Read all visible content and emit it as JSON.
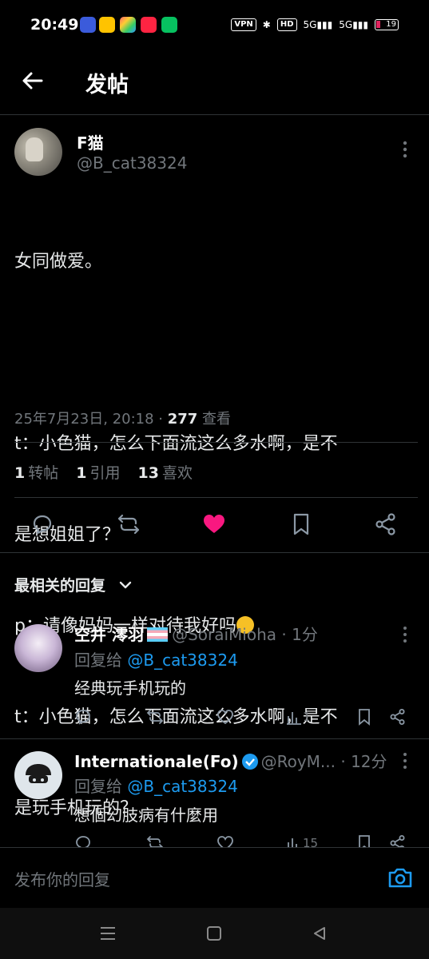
{
  "status_bar": {
    "time": "20:49",
    "vpn": "VPN",
    "hd": "HD",
    "signal1": "5G",
    "signal2": "5G",
    "battery": "19",
    "app_icons": [
      "meituan-icon",
      "meituan-icon",
      "colorful-app-icon",
      "xiaohongshu-icon",
      "wechat-icon"
    ]
  },
  "header": {
    "title": "发帖"
  },
  "post": {
    "display_name": "F猫",
    "handle": "@B_cat38324",
    "lines": [
      "女同做爱。",
      "",
      "t：小色猫，怎么下面流这么多水啊，是不",
      "是想姐姐了？",
      "p：请像妈妈一样对待我好吗",
      "t：小色猫，怎么下面流这么多水啊，是不",
      "是玩手机玩的？"
    ],
    "timestamp": "25年7月23日, 20:18 · ",
    "views_count": "277",
    "views_label": " 查看",
    "stats": [
      {
        "count": "1",
        "label": "转帖"
      },
      {
        "count": "1",
        "label": "引用"
      },
      {
        "count": "13",
        "label": "喜欢"
      }
    ]
  },
  "replies_header": {
    "label": "最相关的回复"
  },
  "replies": [
    {
      "name": "空井 澪羽",
      "handle": "@SoraiMioha",
      "time": " · 1分",
      "reply_to_prefix": "回复给 ",
      "reply_to_handle": "@B_cat38324",
      "text": "经典玩手机玩的",
      "views": "1"
    },
    {
      "name": "Internationale(Fo)",
      "handle": "@RoyM...",
      "time": " · 12分",
      "reply_to_prefix": "回复给 ",
      "reply_to_handle": "@B_cat38324",
      "text": "想個幻肢病有什麼用",
      "views": "15"
    }
  ],
  "composer": {
    "placeholder": "发布你的回复"
  },
  "colors": {
    "background": "#000000",
    "accent": "#1d9bf0",
    "like": "#f91880",
    "muted": "#71767b",
    "divider": "#2f3336"
  }
}
